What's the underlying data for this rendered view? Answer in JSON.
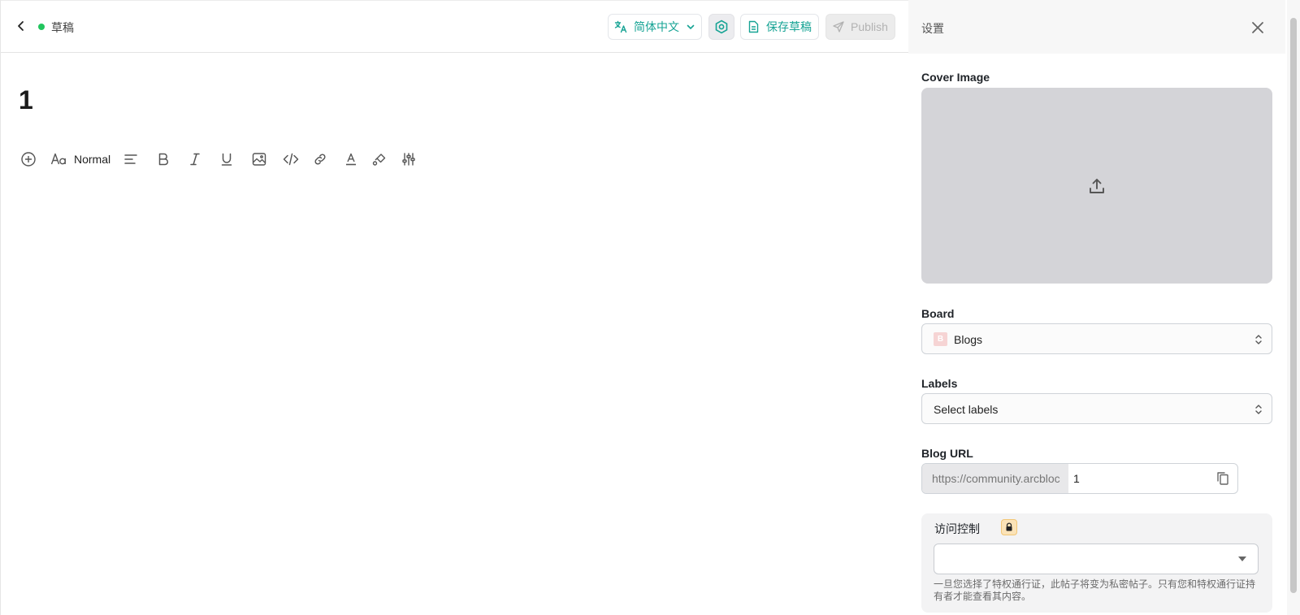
{
  "header": {
    "status": "草稿",
    "status_color": "#22c55e",
    "language": "简体中文",
    "save_label": "保存草稿",
    "publish_label": "Publish"
  },
  "document": {
    "title": "1"
  },
  "toolbar": {
    "text_style": "Normal",
    "tools": [
      "add-icon",
      "font-icon",
      "align-icon",
      "bold-icon",
      "italic-icon",
      "underline-icon",
      "image-icon",
      "code-icon",
      "link-icon",
      "text-color-icon",
      "highlight-icon",
      "sliders-icon"
    ]
  },
  "panel": {
    "title": "设置",
    "cover_label": "Cover Image",
    "board_label": "Board",
    "board_value": "Blogs",
    "board_badge": "B",
    "labels_label": "Labels",
    "labels_placeholder": "Select labels",
    "url_label": "Blog URL",
    "url_prefix": "https://community.arcbloc",
    "url_slug": "1",
    "access_label": "访问控制",
    "access_help": "一旦您选择了特权通行证，此帖子将变为私密帖子。只有您和特权通行证持有者才能查看其内容。"
  },
  "colors": {
    "accent": "#16a394",
    "cover_bg": "#d4d4d8"
  }
}
